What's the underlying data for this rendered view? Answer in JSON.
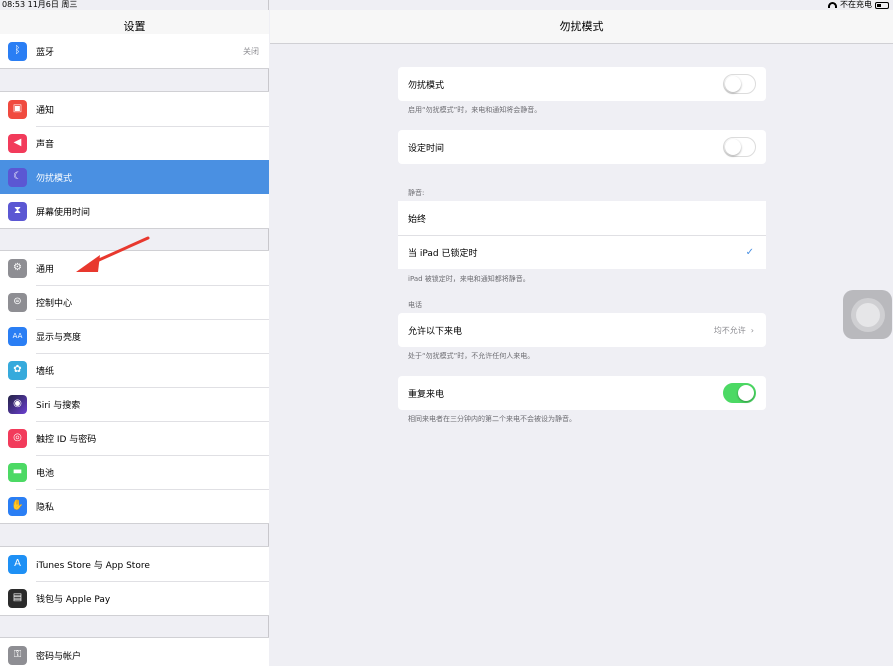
{
  "status_bar": {
    "time": "08:53",
    "date": "11月6日 周三",
    "charging": "不在充电"
  },
  "sidebar": {
    "title": "设置",
    "groups": [
      {
        "items": [
          {
            "label": "蓝牙",
            "value": "关闭",
            "icon": "bluetooth-icon",
            "color": "#2a7ef4"
          }
        ]
      },
      {
        "items": [
          {
            "label": "通知",
            "icon": "notifications-icon",
            "color": "#f04a3f"
          },
          {
            "label": "声音",
            "icon": "sound-icon",
            "color": "#f23b5b"
          },
          {
            "label": "勿扰模式",
            "icon": "moon-icon",
            "color": "#5b57d3",
            "active": true
          },
          {
            "label": "屏幕使用时间",
            "icon": "hourglass-icon",
            "color": "#5b57d3"
          }
        ]
      },
      {
        "items": [
          {
            "label": "通用",
            "icon": "gear-icon",
            "color": "#8e8e93"
          },
          {
            "label": "控制中心",
            "icon": "switches-icon",
            "color": "#8e8e93"
          },
          {
            "label": "显示与亮度",
            "icon": "display-icon",
            "color": "#2a7ef4"
          },
          {
            "label": "墙纸",
            "icon": "wallpaper-icon",
            "color": "#36aadc"
          },
          {
            "label": "Siri 与搜索",
            "icon": "siri-icon",
            "color": "#222244"
          },
          {
            "label": "触控 ID 与密码",
            "icon": "fingerprint-icon",
            "color": "#f23b5b"
          },
          {
            "label": "电池",
            "icon": "battery-icon",
            "color": "#4cd964"
          },
          {
            "label": "隐私",
            "icon": "hand-icon",
            "color": "#2a7ef4"
          }
        ]
      },
      {
        "items": [
          {
            "label": "iTunes Store 与 App Store",
            "icon": "appstore-icon",
            "color": "#1e90f5"
          },
          {
            "label": "钱包与 Apple Pay",
            "icon": "wallet-icon",
            "color": "#2b2b2b"
          }
        ]
      },
      {
        "items": [
          {
            "label": "密码与帐户",
            "icon": "key-icon",
            "color": "#8e8e93"
          }
        ]
      }
    ]
  },
  "main": {
    "title": "勿扰模式",
    "dnd": {
      "label": "勿扰模式",
      "on": false,
      "footnote": "启用“勿扰模式”时，来电和通知将会静音。"
    },
    "scheduled": {
      "label": "设定时间",
      "on": false
    },
    "silence": {
      "section": "静音:",
      "always": "始终",
      "locked": "当 iPad 已锁定时",
      "footnote": "iPad 被锁定时，来电和通知都将静音。"
    },
    "phone": {
      "section": "电话",
      "allow_calls": "允许以下来电",
      "allow_value": "均不允许",
      "footnote": "处于“勿扰模式”时，不允许任何人来电。"
    },
    "repeated": {
      "label": "重复来电",
      "on": true,
      "footnote": "相同来电者在三分钟内的第二个来电不会被设为静音。"
    }
  },
  "colors": {
    "accent": "#4a90e2",
    "toggle_on": "#4cd964",
    "arrow": "#e8382e"
  }
}
